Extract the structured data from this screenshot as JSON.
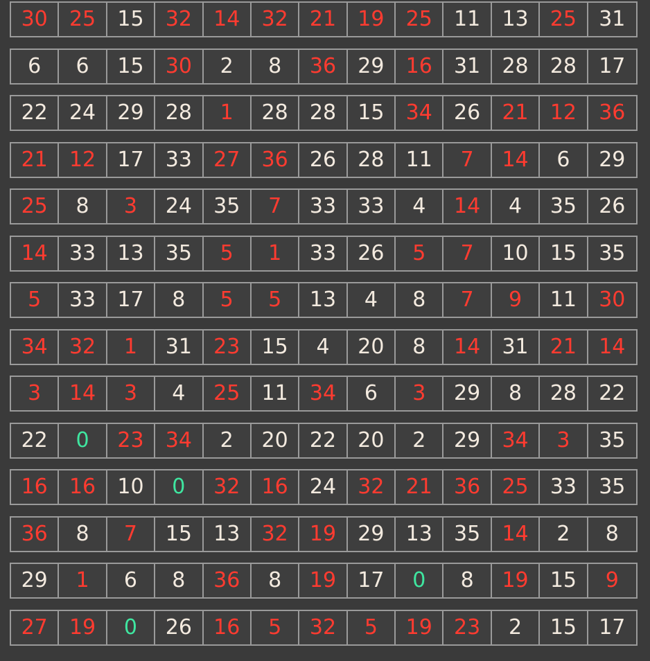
{
  "colors": {
    "red": "#ff3b30",
    "white": "#f3eadf",
    "green": "#3fe6a0",
    "background": "#3a3a3a",
    "border": "#9a9a9a"
  },
  "board": {
    "rows": [
      [
        {
          "v": "30",
          "c": "red"
        },
        {
          "v": "25",
          "c": "red"
        },
        {
          "v": "15",
          "c": "white"
        },
        {
          "v": "32",
          "c": "red"
        },
        {
          "v": "14",
          "c": "red"
        },
        {
          "v": "32",
          "c": "red"
        },
        {
          "v": "21",
          "c": "red"
        },
        {
          "v": "19",
          "c": "red"
        },
        {
          "v": "25",
          "c": "red"
        },
        {
          "v": "11",
          "c": "white"
        },
        {
          "v": "13",
          "c": "white"
        },
        {
          "v": "25",
          "c": "red"
        },
        {
          "v": "31",
          "c": "white"
        }
      ],
      [
        {
          "v": "6",
          "c": "white"
        },
        {
          "v": "6",
          "c": "white"
        },
        {
          "v": "15",
          "c": "white"
        },
        {
          "v": "30",
          "c": "red"
        },
        {
          "v": "2",
          "c": "white"
        },
        {
          "v": "8",
          "c": "white"
        },
        {
          "v": "36",
          "c": "red"
        },
        {
          "v": "29",
          "c": "white"
        },
        {
          "v": "16",
          "c": "red"
        },
        {
          "v": "31",
          "c": "white"
        },
        {
          "v": "28",
          "c": "white"
        },
        {
          "v": "28",
          "c": "white"
        },
        {
          "v": "17",
          "c": "white"
        }
      ],
      [
        {
          "v": "22",
          "c": "white"
        },
        {
          "v": "24",
          "c": "white"
        },
        {
          "v": "29",
          "c": "white"
        },
        {
          "v": "28",
          "c": "white"
        },
        {
          "v": "1",
          "c": "red"
        },
        {
          "v": "28",
          "c": "white"
        },
        {
          "v": "28",
          "c": "white"
        },
        {
          "v": "15",
          "c": "white"
        },
        {
          "v": "34",
          "c": "red"
        },
        {
          "v": "26",
          "c": "white"
        },
        {
          "v": "21",
          "c": "red"
        },
        {
          "v": "12",
          "c": "red"
        },
        {
          "v": "36",
          "c": "red"
        }
      ],
      [
        {
          "v": "21",
          "c": "red"
        },
        {
          "v": "12",
          "c": "red"
        },
        {
          "v": "17",
          "c": "white"
        },
        {
          "v": "33",
          "c": "white"
        },
        {
          "v": "27",
          "c": "red"
        },
        {
          "v": "36",
          "c": "red"
        },
        {
          "v": "26",
          "c": "white"
        },
        {
          "v": "28",
          "c": "white"
        },
        {
          "v": "11",
          "c": "white"
        },
        {
          "v": "7",
          "c": "red"
        },
        {
          "v": "14",
          "c": "red"
        },
        {
          "v": "6",
          "c": "white"
        },
        {
          "v": "29",
          "c": "white"
        }
      ],
      [
        {
          "v": "25",
          "c": "red"
        },
        {
          "v": "8",
          "c": "white"
        },
        {
          "v": "3",
          "c": "red"
        },
        {
          "v": "24",
          "c": "white"
        },
        {
          "v": "35",
          "c": "white"
        },
        {
          "v": "7",
          "c": "red"
        },
        {
          "v": "33",
          "c": "white"
        },
        {
          "v": "33",
          "c": "white"
        },
        {
          "v": "4",
          "c": "white"
        },
        {
          "v": "14",
          "c": "red"
        },
        {
          "v": "4",
          "c": "white"
        },
        {
          "v": "35",
          "c": "white"
        },
        {
          "v": "26",
          "c": "white"
        }
      ],
      [
        {
          "v": "14",
          "c": "red"
        },
        {
          "v": "33",
          "c": "white"
        },
        {
          "v": "13",
          "c": "white"
        },
        {
          "v": "35",
          "c": "white"
        },
        {
          "v": "5",
          "c": "red"
        },
        {
          "v": "1",
          "c": "red"
        },
        {
          "v": "33",
          "c": "white"
        },
        {
          "v": "26",
          "c": "white"
        },
        {
          "v": "5",
          "c": "red"
        },
        {
          "v": "7",
          "c": "red"
        },
        {
          "v": "10",
          "c": "white"
        },
        {
          "v": "15",
          "c": "white"
        },
        {
          "v": "35",
          "c": "white"
        }
      ],
      [
        {
          "v": "5",
          "c": "red"
        },
        {
          "v": "33",
          "c": "white"
        },
        {
          "v": "17",
          "c": "white"
        },
        {
          "v": "8",
          "c": "white"
        },
        {
          "v": "5",
          "c": "red"
        },
        {
          "v": "5",
          "c": "red"
        },
        {
          "v": "13",
          "c": "white"
        },
        {
          "v": "4",
          "c": "white"
        },
        {
          "v": "8",
          "c": "white"
        },
        {
          "v": "7",
          "c": "red"
        },
        {
          "v": "9",
          "c": "red"
        },
        {
          "v": "11",
          "c": "white"
        },
        {
          "v": "30",
          "c": "red"
        }
      ],
      [
        {
          "v": "34",
          "c": "red"
        },
        {
          "v": "32",
          "c": "red"
        },
        {
          "v": "1",
          "c": "red"
        },
        {
          "v": "31",
          "c": "white"
        },
        {
          "v": "23",
          "c": "red"
        },
        {
          "v": "15",
          "c": "white"
        },
        {
          "v": "4",
          "c": "white"
        },
        {
          "v": "20",
          "c": "white"
        },
        {
          "v": "8",
          "c": "white"
        },
        {
          "v": "14",
          "c": "red"
        },
        {
          "v": "31",
          "c": "white"
        },
        {
          "v": "21",
          "c": "red"
        },
        {
          "v": "14",
          "c": "red"
        }
      ],
      [
        {
          "v": "3",
          "c": "red"
        },
        {
          "v": "14",
          "c": "red"
        },
        {
          "v": "3",
          "c": "red"
        },
        {
          "v": "4",
          "c": "white"
        },
        {
          "v": "25",
          "c": "red"
        },
        {
          "v": "11",
          "c": "white"
        },
        {
          "v": "34",
          "c": "red"
        },
        {
          "v": "6",
          "c": "white"
        },
        {
          "v": "3",
          "c": "red"
        },
        {
          "v": "29",
          "c": "white"
        },
        {
          "v": "8",
          "c": "white"
        },
        {
          "v": "28",
          "c": "white"
        },
        {
          "v": "22",
          "c": "white"
        }
      ],
      [
        {
          "v": "22",
          "c": "white"
        },
        {
          "v": "0",
          "c": "green"
        },
        {
          "v": "23",
          "c": "red"
        },
        {
          "v": "34",
          "c": "red"
        },
        {
          "v": "2",
          "c": "white"
        },
        {
          "v": "20",
          "c": "white"
        },
        {
          "v": "22",
          "c": "white"
        },
        {
          "v": "20",
          "c": "white"
        },
        {
          "v": "2",
          "c": "white"
        },
        {
          "v": "29",
          "c": "white"
        },
        {
          "v": "34",
          "c": "red"
        },
        {
          "v": "3",
          "c": "red"
        },
        {
          "v": "35",
          "c": "white"
        }
      ],
      [
        {
          "v": "16",
          "c": "red"
        },
        {
          "v": "16",
          "c": "red"
        },
        {
          "v": "10",
          "c": "white"
        },
        {
          "v": "0",
          "c": "green"
        },
        {
          "v": "32",
          "c": "red"
        },
        {
          "v": "16",
          "c": "red"
        },
        {
          "v": "24",
          "c": "white"
        },
        {
          "v": "32",
          "c": "red"
        },
        {
          "v": "21",
          "c": "red"
        },
        {
          "v": "36",
          "c": "red"
        },
        {
          "v": "25",
          "c": "red"
        },
        {
          "v": "33",
          "c": "white"
        },
        {
          "v": "35",
          "c": "white"
        }
      ],
      [
        {
          "v": "36",
          "c": "red"
        },
        {
          "v": "8",
          "c": "white"
        },
        {
          "v": "7",
          "c": "red"
        },
        {
          "v": "15",
          "c": "white"
        },
        {
          "v": "13",
          "c": "white"
        },
        {
          "v": "32",
          "c": "red"
        },
        {
          "v": "19",
          "c": "red"
        },
        {
          "v": "29",
          "c": "white"
        },
        {
          "v": "13",
          "c": "white"
        },
        {
          "v": "35",
          "c": "white"
        },
        {
          "v": "14",
          "c": "red"
        },
        {
          "v": "2",
          "c": "white"
        },
        {
          "v": "8",
          "c": "white"
        }
      ],
      [
        {
          "v": "29",
          "c": "white"
        },
        {
          "v": "1",
          "c": "red"
        },
        {
          "v": "6",
          "c": "white"
        },
        {
          "v": "8",
          "c": "white"
        },
        {
          "v": "36",
          "c": "red"
        },
        {
          "v": "8",
          "c": "white"
        },
        {
          "v": "19",
          "c": "red"
        },
        {
          "v": "17",
          "c": "white"
        },
        {
          "v": "0",
          "c": "green"
        },
        {
          "v": "8",
          "c": "white"
        },
        {
          "v": "19",
          "c": "red"
        },
        {
          "v": "15",
          "c": "white"
        },
        {
          "v": "9",
          "c": "red"
        }
      ],
      [
        {
          "v": "27",
          "c": "red"
        },
        {
          "v": "19",
          "c": "red"
        },
        {
          "v": "0",
          "c": "green"
        },
        {
          "v": "26",
          "c": "white"
        },
        {
          "v": "16",
          "c": "red"
        },
        {
          "v": "5",
          "c": "red"
        },
        {
          "v": "32",
          "c": "red"
        },
        {
          "v": "5",
          "c": "red"
        },
        {
          "v": "19",
          "c": "red"
        },
        {
          "v": "23",
          "c": "red"
        },
        {
          "v": "2",
          "c": "white"
        },
        {
          "v": "15",
          "c": "white"
        },
        {
          "v": "17",
          "c": "white"
        }
      ]
    ]
  }
}
